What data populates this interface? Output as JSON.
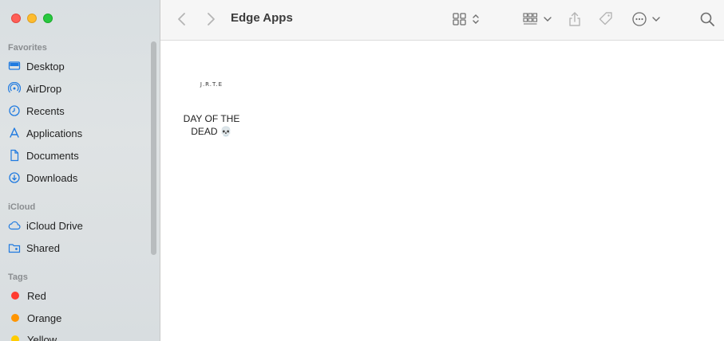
{
  "window": {
    "title": "Edge Apps"
  },
  "sidebar": {
    "favorites_title": "Favorites",
    "favorites": [
      {
        "label": "Desktop",
        "icon": "desktop-icon"
      },
      {
        "label": "AirDrop",
        "icon": "airdrop-icon"
      },
      {
        "label": "Recents",
        "icon": "clock-icon"
      },
      {
        "label": "Applications",
        "icon": "applications-icon"
      },
      {
        "label": "Documents",
        "icon": "document-icon"
      },
      {
        "label": "Downloads",
        "icon": "download-icon"
      }
    ],
    "icloud_title": "iCloud",
    "icloud": [
      {
        "label": "iCloud Drive",
        "icon": "cloud-icon"
      },
      {
        "label": "Shared",
        "icon": "shared-folder-icon"
      }
    ],
    "tags_title": "Tags",
    "tags": [
      {
        "label": "Red",
        "color": "#ff3b30"
      },
      {
        "label": "Orange",
        "color": "#ff9500"
      },
      {
        "label": "Yellow",
        "color": "#ffcc00"
      }
    ]
  },
  "files": [
    {
      "thumb_text": "J.R.T.E",
      "name_line1": "DAY OF THE",
      "name_line2": "DEAD 💀"
    }
  ],
  "colors": {
    "accent": "#1a73e8",
    "sidebar_icon": "#1f7ae0"
  }
}
